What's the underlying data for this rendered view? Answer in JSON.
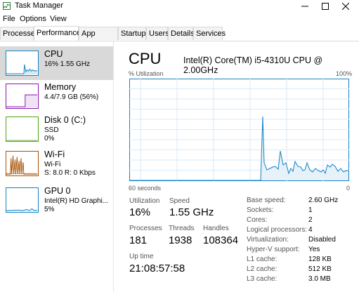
{
  "window": {
    "title": "Task Manager"
  },
  "menu": [
    "File",
    "Options",
    "View"
  ],
  "tabs": [
    {
      "label": "Processes"
    },
    {
      "label": "Performance"
    },
    {
      "label": "App history"
    },
    {
      "label": "Startup"
    },
    {
      "label": "Users"
    },
    {
      "label": "Details"
    },
    {
      "label": "Services"
    }
  ],
  "sidebar": {
    "items": [
      {
        "title": "CPU",
        "line1": "16%  1.55 GHz",
        "line2": "",
        "color": "#1183c7"
      },
      {
        "title": "Memory",
        "line1": "4.4/7.9 GB (56%)",
        "line2": "",
        "color": "#8b12ae"
      },
      {
        "title": "Disk 0 (C:)",
        "line1": "SSD",
        "line2": "0%",
        "color": "#4da60c"
      },
      {
        "title": "Wi-Fi",
        "line1": "Wi-Fi",
        "line2": "S: 8.0  R: 0 Kbps",
        "color": "#a74f01"
      },
      {
        "title": "GPU 0",
        "line1": "Intel(R) HD Graphi...",
        "line2": "5%",
        "color": "#1183c7"
      }
    ]
  },
  "main": {
    "title": "CPU",
    "model": "Intel(R) Core(TM) i5-4310U CPU @ 2.00GHz",
    "graph_label": "% Utilization",
    "graph_max": "100%",
    "graph_time": "60 seconds",
    "graph_min": "0",
    "utilization_label": "Utilization",
    "utilization": "16%",
    "speed_label": "Speed",
    "speed": "1.55 GHz",
    "processes_label": "Processes",
    "processes": "181",
    "threads_label": "Threads",
    "threads": "1938",
    "handles_label": "Handles",
    "handles": "108364",
    "uptime_label": "Up time",
    "uptime": "21:08:57:58",
    "specs": [
      {
        "label": "Base speed:",
        "value": "2.60 GHz"
      },
      {
        "label": "Sockets:",
        "value": "1"
      },
      {
        "label": "Cores:",
        "value": "2"
      },
      {
        "label": "Logical processors:",
        "value": "4"
      },
      {
        "label": "Virtualization:",
        "value": "Disabled"
      },
      {
        "label": "Hyper-V support:",
        "value": "Yes"
      },
      {
        "label": "L1 cache:",
        "value": "128 KB"
      },
      {
        "label": "L2 cache:",
        "value": "512 KB"
      },
      {
        "label": "L3 cache:",
        "value": "3.0 MB"
      }
    ]
  },
  "colors": {
    "cpu_line": "#1183c7",
    "cpu_fill": "#e6f1f9",
    "grid": "#d9eaf7",
    "border": "#1183c7"
  }
}
